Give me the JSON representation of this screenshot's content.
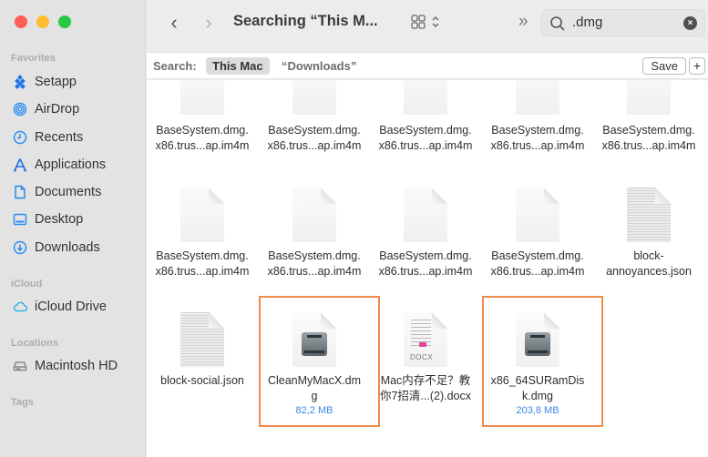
{
  "window": {
    "title": "Searching “This M...",
    "traffic_lights": [
      "close",
      "minimize",
      "zoom"
    ]
  },
  "sidebar": {
    "sections": [
      {
        "label": "Favorites",
        "items": [
          {
            "label": "Setapp",
            "icon": "setapp-icon"
          },
          {
            "label": "AirDrop",
            "icon": "airdrop-icon"
          },
          {
            "label": "Recents",
            "icon": "clock-icon"
          },
          {
            "label": "Applications",
            "icon": "applications-icon"
          },
          {
            "label": "Documents",
            "icon": "document-icon"
          },
          {
            "label": "Desktop",
            "icon": "desktop-icon"
          },
          {
            "label": "Downloads",
            "icon": "download-icon"
          }
        ]
      },
      {
        "label": "iCloud",
        "items": [
          {
            "label": "iCloud Drive",
            "icon": "cloud-icon"
          }
        ]
      },
      {
        "label": "Locations",
        "items": [
          {
            "label": "Macintosh HD",
            "icon": "hard-drive-icon"
          }
        ]
      },
      {
        "label": "Tags",
        "items": []
      }
    ]
  },
  "toolbar": {
    "back": "‹",
    "forward": "›",
    "more": "»",
    "search": {
      "value": ".dmg",
      "clear": "×"
    }
  },
  "scope_bar": {
    "label": "Search:",
    "scopes": [
      "This Mac",
      "“Downloads”"
    ],
    "selected": "This Mac",
    "save_label": "Save",
    "add_label": "+"
  },
  "files": [
    {
      "name": "BaseSystem.dmg.\nx86.trus...ap.im4m",
      "type": "blank"
    },
    {
      "name": "BaseSystem.dmg.\nx86.trus...ap.im4m",
      "type": "blank"
    },
    {
      "name": "BaseSystem.dmg.\nx86.trus...ap.im4m",
      "type": "blank"
    },
    {
      "name": "BaseSystem.dmg.\nx86.trus...ap.im4m",
      "type": "blank"
    },
    {
      "name": "BaseSystem.dmg.\nx86.trus...ap.im4m",
      "type": "blank"
    },
    {
      "name": "BaseSystem.dmg.\nx86.trus...ap.im4m",
      "type": "blank"
    },
    {
      "name": "BaseSystem.dmg.\nx86.trus...ap.im4m",
      "type": "blank"
    },
    {
      "name": "BaseSystem.dmg.\nx86.trus...ap.im4m",
      "type": "blank"
    },
    {
      "name": "BaseSystem.dmg.\nx86.trus...ap.im4m",
      "type": "blank"
    },
    {
      "name": "block-\nannoyances.json",
      "type": "text"
    },
    {
      "name": "block-social.json",
      "type": "text"
    },
    {
      "name": "CleanMyMacX.dm\ng",
      "type": "dmg",
      "size": "82,2 MB",
      "highlighted": true
    },
    {
      "name": "Mac内存不足？教\n你7招清...(2).docx",
      "type": "docx"
    },
    {
      "name": "x86_64SURamDis\nk.dmg",
      "type": "dmg",
      "size": "203,8 MB",
      "highlighted": true
    }
  ],
  "colors": {
    "highlight": "#f08a4b",
    "accent": "#3d87e0",
    "close": "#fe5f57",
    "minimize": "#febc2e",
    "zoom": "#28c840"
  }
}
